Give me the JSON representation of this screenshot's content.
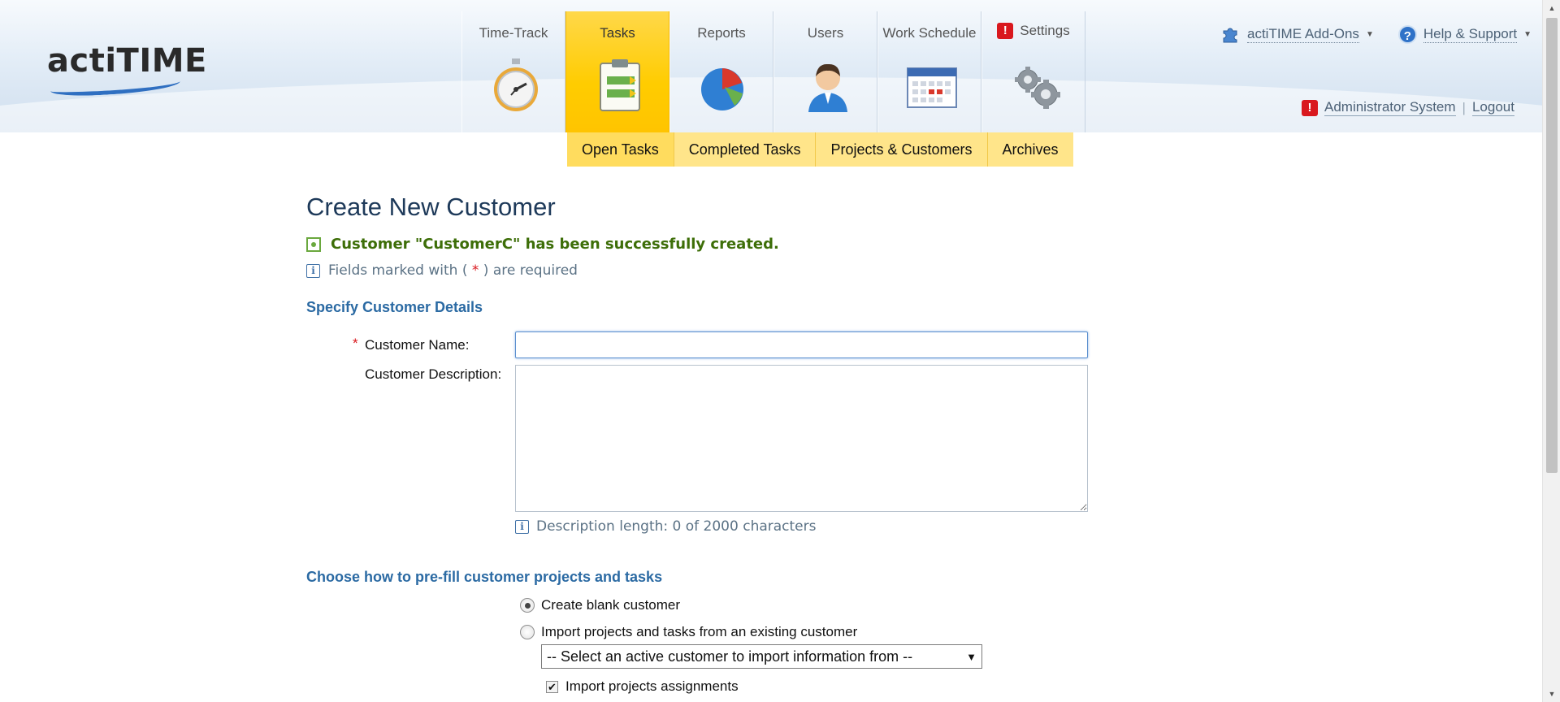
{
  "brand": {
    "logo_text": "actiTIME"
  },
  "nav": {
    "tabs": [
      {
        "label": "Time-Track",
        "icon": "stopwatch-icon"
      },
      {
        "label": "Tasks",
        "icon": "clipboard-icon",
        "active": true
      },
      {
        "label": "Reports",
        "icon": "pie-chart-icon"
      },
      {
        "label": "Users",
        "icon": "user-icon"
      },
      {
        "label": "Work Schedule",
        "icon": "calendar-icon"
      },
      {
        "label": "Settings",
        "icon": "gears-icon",
        "alert": "!"
      }
    ]
  },
  "top_links": {
    "addons": "actiTIME Add-Ons",
    "help": "Help & Support",
    "help_icon_glyph": "?"
  },
  "user": {
    "name": "Administrator System",
    "logout": "Logout",
    "alert": "!"
  },
  "subnav": [
    "Open Tasks",
    "Completed Tasks",
    "Projects & Customers",
    "Archives"
  ],
  "page": {
    "title": "Create New Customer",
    "success_message": "Customer \"CustomerC\" has been successfully created.",
    "required_note_prefix": "Fields marked with (",
    "required_star": "*",
    "required_note_suffix": ") are required",
    "info_glyph": "i"
  },
  "details": {
    "section_title": "Specify Customer Details",
    "name_label": "Customer Name:",
    "name_value": "",
    "description_label": "Customer Description:",
    "description_value": "",
    "description_length": "Description length: 0 of 2000 characters"
  },
  "prefill": {
    "section_title": "Choose how to pre-fill customer projects and tasks",
    "option_blank": "Create blank customer",
    "option_import": "Import projects and tasks from an existing customer",
    "selected": "blank",
    "select_placeholder": "-- Select an active customer to import information from --",
    "import_assignments_label": "Import projects assignments",
    "import_assignments_checked": true
  },
  "colors": {
    "accent_yellow": "#ffcc00",
    "success_green": "#3d6e08",
    "link_blue": "#2b6aa3",
    "required_red": "#d9181e"
  }
}
